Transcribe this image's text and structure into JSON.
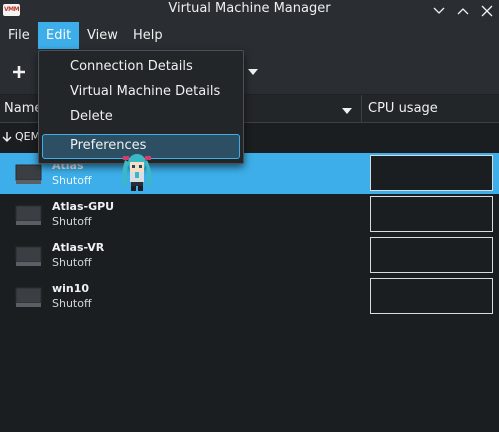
{
  "window": {
    "title": "Virtual Machine Manager",
    "logo_text": "VMM",
    "controls": [
      "chevron-down-icon",
      "chevron-up-icon",
      "close-icon"
    ]
  },
  "menubar": {
    "file": "File",
    "edit": "Edit",
    "view": "View",
    "help": "Help"
  },
  "edit_menu": {
    "items": [
      "Connection Details",
      "Virtual Machine Details",
      "Delete",
      "Preferences"
    ],
    "highlighted": "Preferences"
  },
  "columns": {
    "name": "Name",
    "cpu": "CPU usage"
  },
  "group": {
    "label": "QEM"
  },
  "vms": [
    {
      "name": "Atlas",
      "status": "Shutoff",
      "selected": true
    },
    {
      "name": "Atlas-GPU",
      "status": "Shutoff",
      "selected": false
    },
    {
      "name": "Atlas-VR",
      "status": "Shutoff",
      "selected": false
    },
    {
      "name": "win10",
      "status": "Shutoff",
      "selected": false
    }
  ],
  "colors": {
    "accent": "#3daee9",
    "background": "#1b1e20",
    "bar": "#2a2e32"
  }
}
